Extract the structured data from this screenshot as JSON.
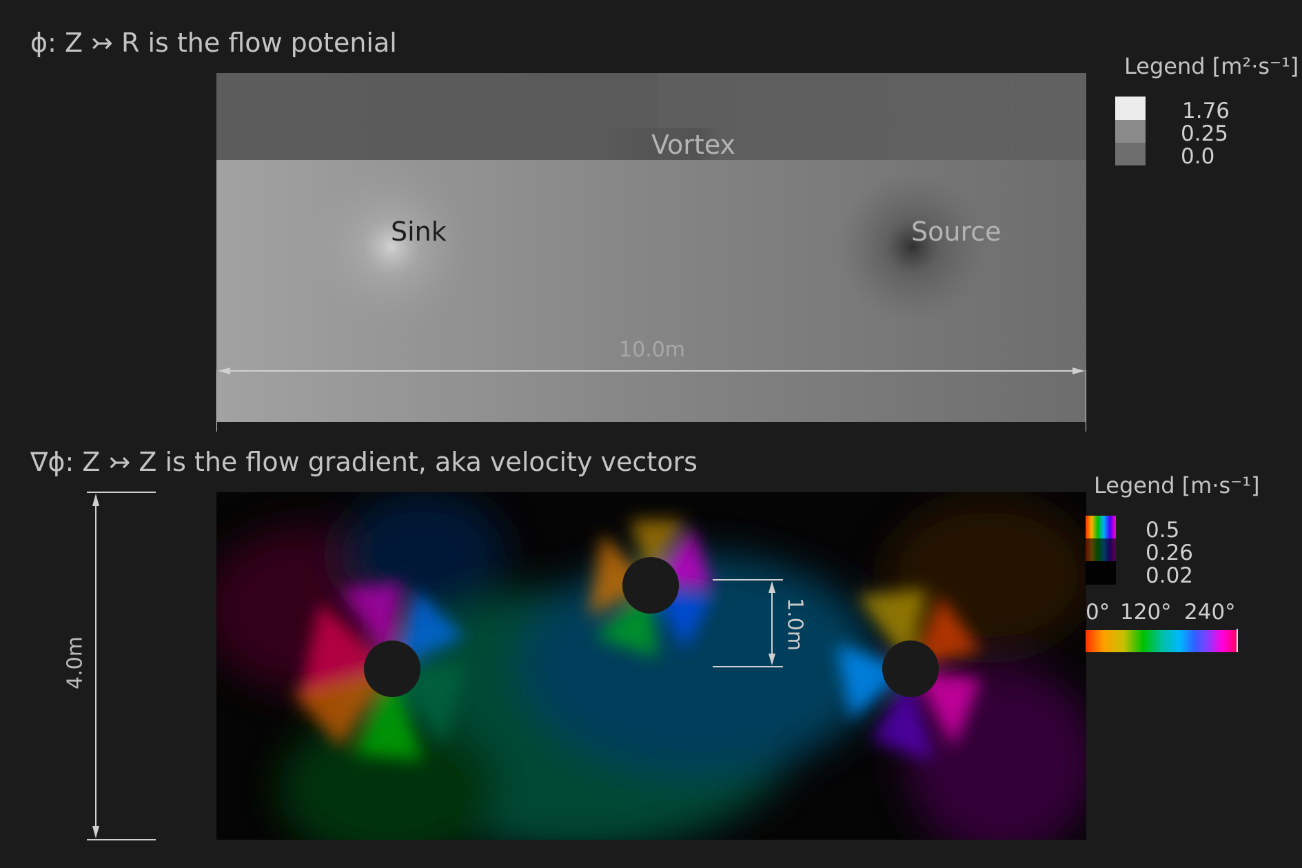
{
  "top": {
    "title": "ϕ: Z ↣ R  is the flow potenial",
    "legend_title": "Legend [m²·s⁻¹]",
    "legend_values": [
      "1.76",
      "0.25",
      "0.0"
    ],
    "legend_colors": [
      "#ececec",
      "#8a8a8a",
      "#6e6e6e"
    ],
    "labels": {
      "sink": "Sink",
      "vortex": "Vortex",
      "source": "Source"
    },
    "width_dim": "10.0m"
  },
  "bottom": {
    "title": "∇ϕ: Z ↣ Z  is the flow gradient, aka velocity vectors",
    "legend_title": "Legend [m·s⁻¹]",
    "legend_values": [
      "0.5",
      "0.26",
      "0.02"
    ],
    "hue_labels": [
      "0°",
      "120°",
      "240°"
    ],
    "height_dim": "4.0m",
    "radius_dim": "1.0m"
  }
}
